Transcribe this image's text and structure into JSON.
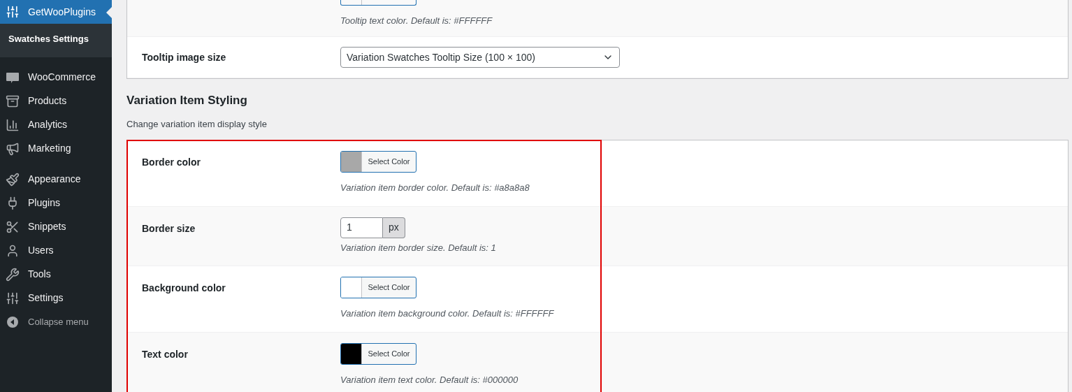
{
  "sidebar": {
    "items": [
      {
        "label": "GetWooPlugins",
        "selected": true
      },
      {
        "label": "WooCommerce",
        "selected": false
      },
      {
        "label": "Products",
        "selected": false
      },
      {
        "label": "Analytics",
        "selected": false
      },
      {
        "label": "Marketing",
        "selected": false
      },
      {
        "label": "Appearance",
        "selected": false
      },
      {
        "label": "Plugins",
        "selected": false
      },
      {
        "label": "Snippets",
        "selected": false
      },
      {
        "label": "Users",
        "selected": false
      },
      {
        "label": "Tools",
        "selected": false
      },
      {
        "label": "Settings",
        "selected": false
      }
    ],
    "submenu": [
      {
        "label": "Swatches Settings",
        "selected": true
      }
    ],
    "collapse": "Collapse menu"
  },
  "top_card": {
    "rows": [
      {
        "kind": "cut-color",
        "description": "Tooltip text color. Default is: #FFFFFF"
      },
      {
        "kind": "select",
        "label": "Tooltip image size",
        "value": "Variation Swatches Tooltip Size (100 × 100)"
      }
    ]
  },
  "section": {
    "title": "Variation Item Styling",
    "description": "Change variation item display style",
    "highlighted": true,
    "rows": [
      {
        "kind": "color",
        "label": "Border color",
        "color": "#a8a8a8",
        "button": "Select Color",
        "description": "Variation item border color. Default is: #a8a8a8"
      },
      {
        "kind": "number",
        "label": "Border size",
        "value": "1",
        "unit": "px",
        "description": "Variation item border size. Default is: 1"
      },
      {
        "kind": "color",
        "label": "Background color",
        "color": "#ffffff",
        "button": "Select Color",
        "description": "Variation item background color. Default is: #FFFFFF"
      },
      {
        "kind": "color",
        "label": "Text color",
        "color": "#000000",
        "button": "Select Color",
        "description": "Variation item text color. Default is: #000000"
      }
    ]
  }
}
